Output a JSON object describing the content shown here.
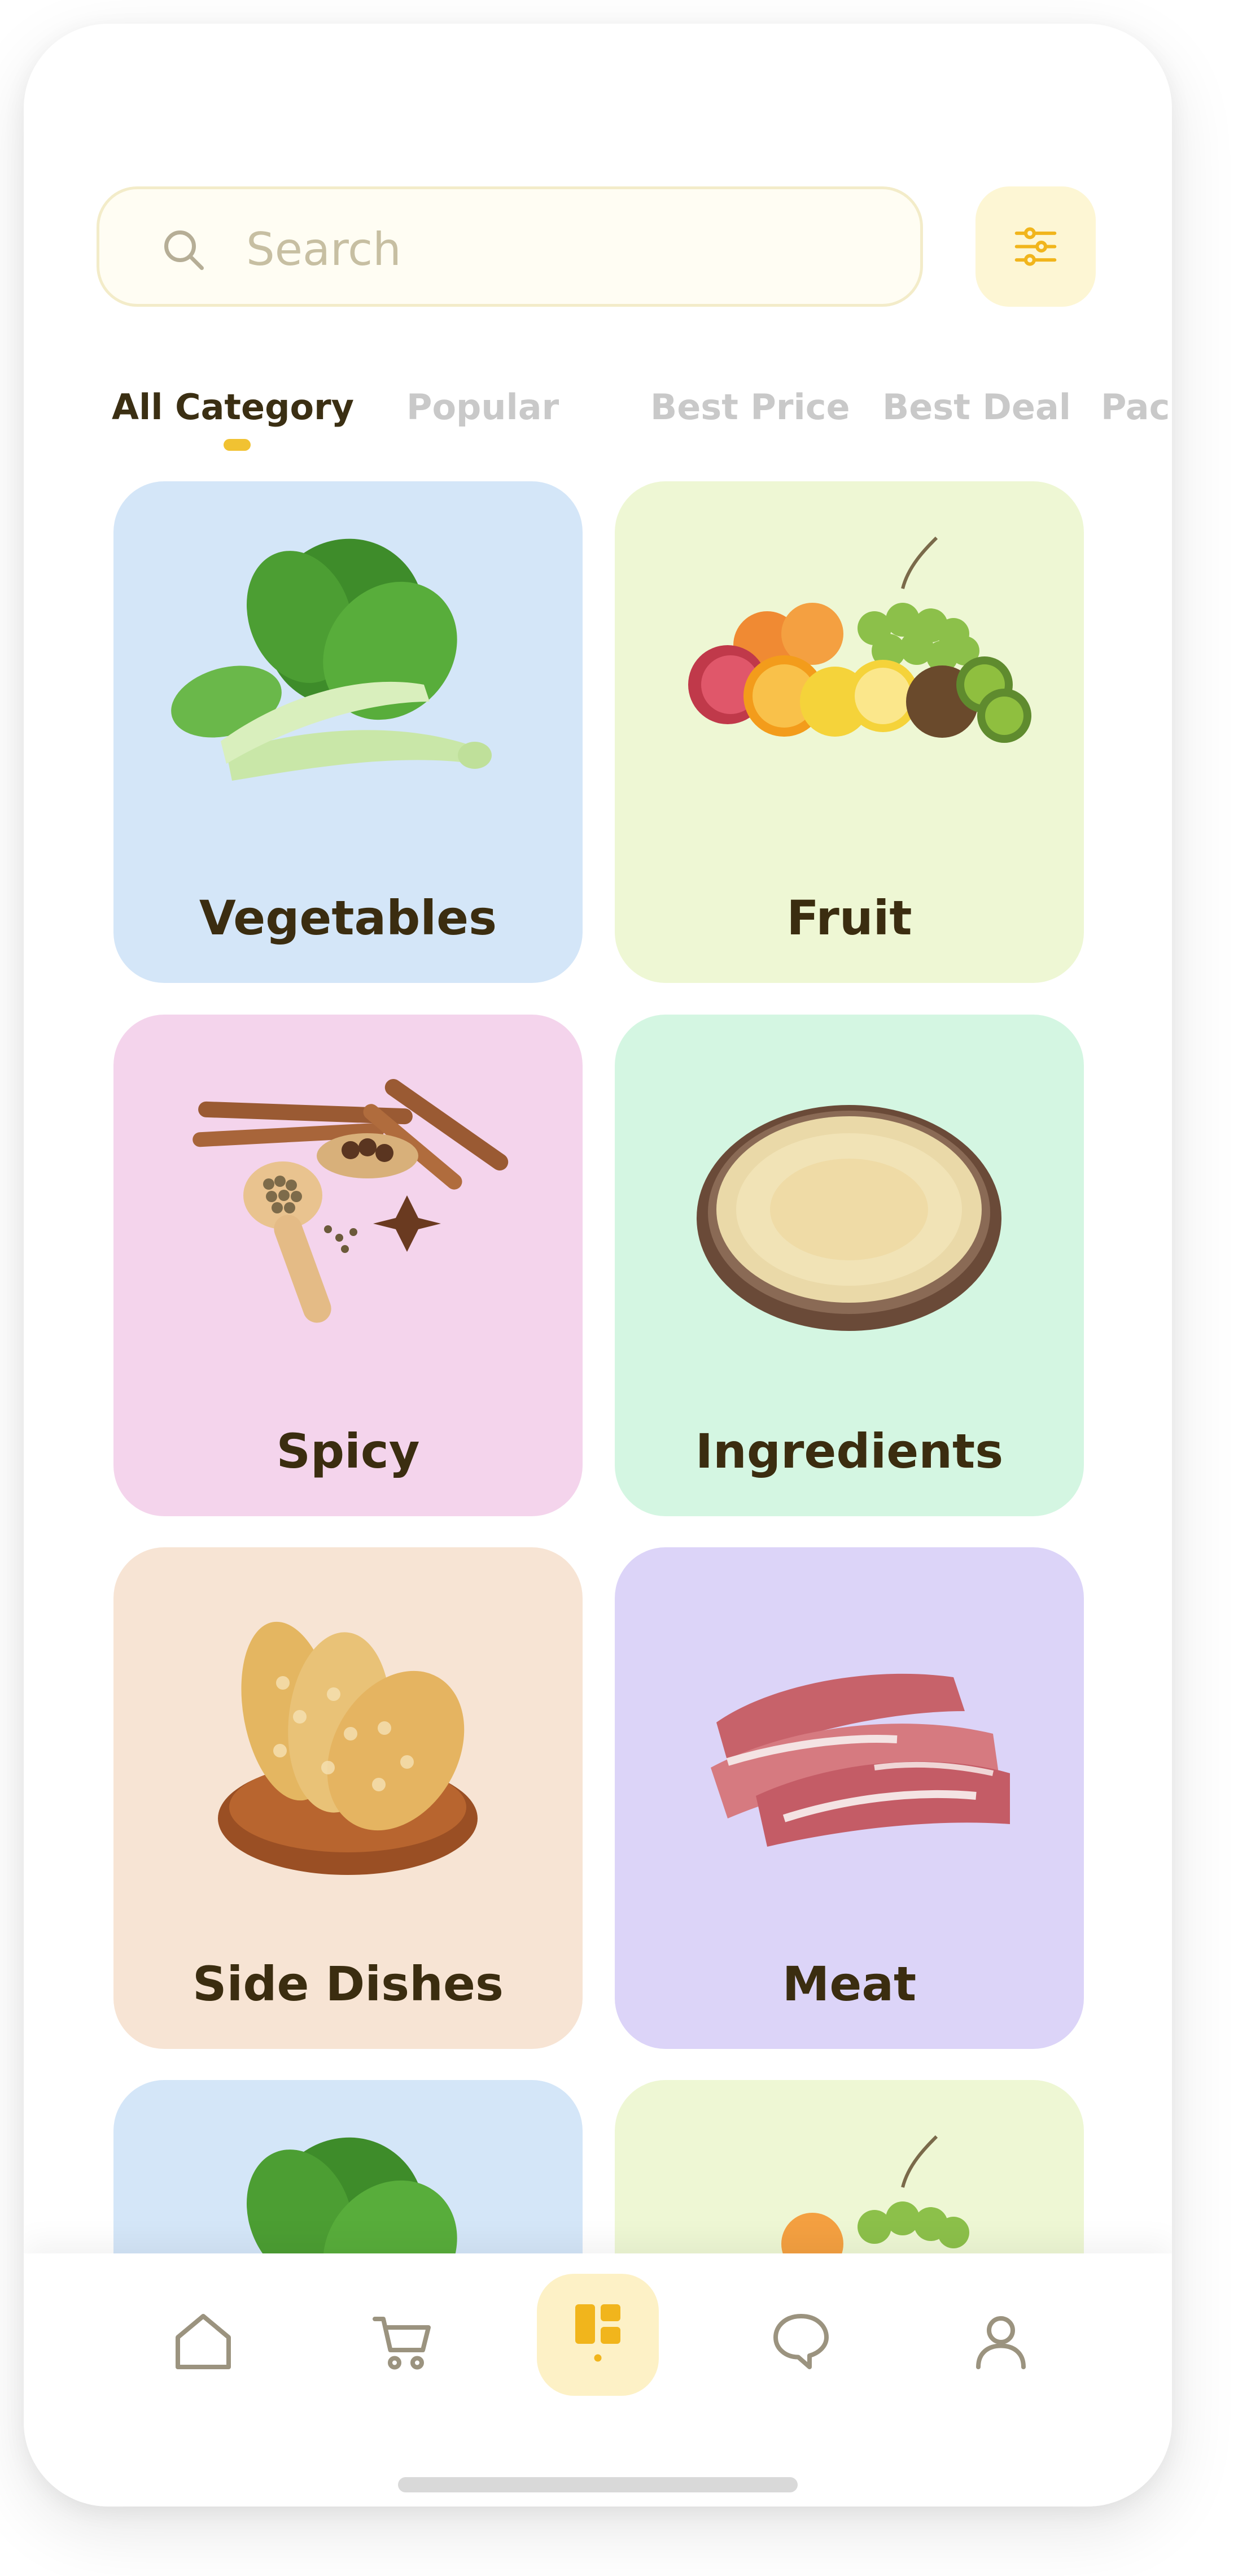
{
  "search": {
    "placeholder": "Search",
    "icon": "search-icon"
  },
  "filter": {
    "icon": "sliders-icon"
  },
  "tabs": [
    {
      "label": "All Category",
      "active": true
    },
    {
      "label": "Popular",
      "active": false
    },
    {
      "label": "Best Price",
      "active": false
    },
    {
      "label": "Best Deal",
      "active": false
    },
    {
      "label": "Package",
      "active": false
    }
  ],
  "categories": [
    {
      "label": "Vegetables",
      "color": "#d4e6f8",
      "icon": "bok-choy-image"
    },
    {
      "label": "Fruit",
      "color": "#eef7d4",
      "icon": "fruit-pile-image"
    },
    {
      "label": "Spicy",
      "color": "#f4d4ec",
      "icon": "spices-image"
    },
    {
      "label": "Ingredients",
      "color": "#d4f6e2",
      "icon": "rice-bowl-image"
    },
    {
      "label": "Side Dishes",
      "color": "#f7e4d4",
      "icon": "tempeh-image"
    },
    {
      "label": "Meat",
      "color": "#dcd4f8",
      "icon": "steak-image"
    },
    {
      "label": "",
      "color": "#d4e6f8",
      "icon": "bok-choy-image"
    },
    {
      "label": "",
      "color": "#eef7d4",
      "icon": "fruit-pile-image"
    }
  ],
  "bottom_nav": [
    {
      "name": "home",
      "icon": "home-icon",
      "active": false
    },
    {
      "name": "cart",
      "icon": "cart-icon",
      "active": false
    },
    {
      "name": "category",
      "icon": "grid-icon",
      "active": true
    },
    {
      "name": "chat",
      "icon": "chat-icon",
      "active": false
    },
    {
      "name": "profile",
      "icon": "user-icon",
      "active": false
    }
  ],
  "colors": {
    "accent": "#f1c232",
    "text_dark": "#3b2d10",
    "tab_inactive": "#c9c9c9",
    "nav_icon": "#9b937f"
  }
}
